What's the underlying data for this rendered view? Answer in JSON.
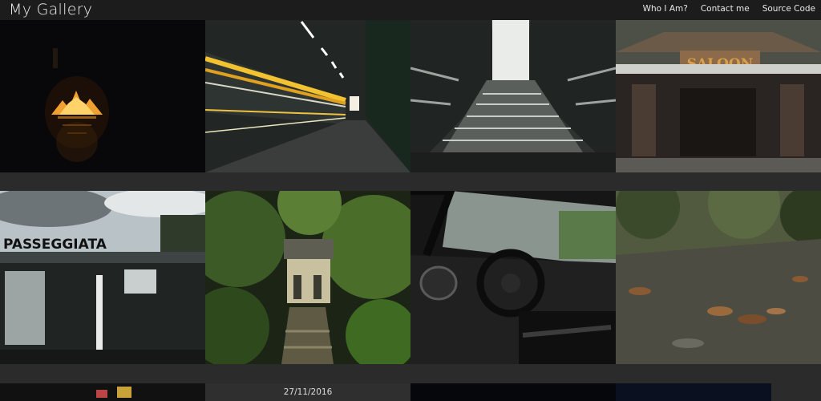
{
  "app": {
    "title": "My Gallery"
  },
  "nav": {
    "items": [
      {
        "label": "Who I Am?"
      },
      {
        "label": "Contact me"
      },
      {
        "label": "Source Code"
      }
    ]
  },
  "sign": {
    "saloon": "SALOON",
    "passeggiata": "PASSEGGIATA"
  },
  "gallery": {
    "caption_date": "27/11/2016"
  }
}
